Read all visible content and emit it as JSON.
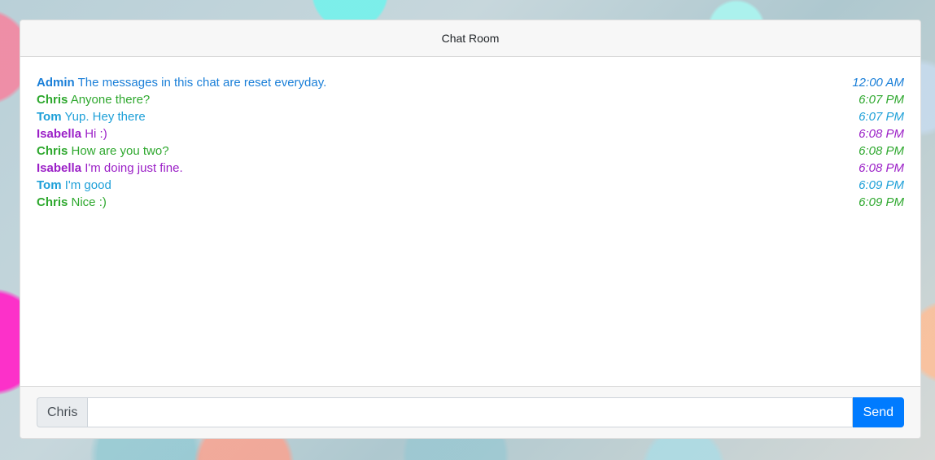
{
  "header": {
    "title": "Chat Room"
  },
  "messages": [
    {
      "author": "Admin",
      "text": "The messages in this chat are reset everyday.",
      "time": "12:00 AM",
      "color": "#1a7fd8"
    },
    {
      "author": "Chris",
      "text": "Anyone there?",
      "time": "6:07 PM",
      "color": "#2ea82e"
    },
    {
      "author": "Tom",
      "text": "Yup. Hey there",
      "time": "6:07 PM",
      "color": "#1ea0d8"
    },
    {
      "author": "Isabella",
      "text": "Hi :)",
      "time": "6:08 PM",
      "color": "#9b1fc7"
    },
    {
      "author": "Chris",
      "text": "How are you two?",
      "time": "6:08 PM",
      "color": "#2ea82e"
    },
    {
      "author": "Isabella",
      "text": "I'm doing just fine.",
      "time": "6:08 PM",
      "color": "#9b1fc7"
    },
    {
      "author": "Tom",
      "text": "I'm good",
      "time": "6:09 PM",
      "color": "#1ea0d8"
    },
    {
      "author": "Chris",
      "text": "Nice :)",
      "time": "6:09 PM",
      "color": "#2ea82e"
    }
  ],
  "composer": {
    "username": "Chris",
    "input_value": "",
    "send_label": "Send"
  }
}
